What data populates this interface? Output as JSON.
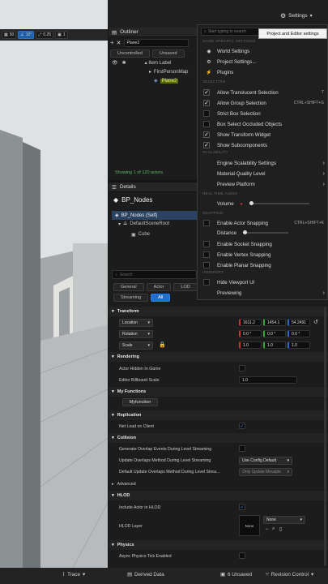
{
  "topbar": {
    "settings_label": "Settings",
    "tooltip": "Project and Editor settings"
  },
  "viewport": {
    "chips": [
      "50",
      "10°",
      "0.25",
      "1"
    ]
  },
  "outliner": {
    "title": "Outliner",
    "search_value": "Plane2",
    "filters": [
      "Uncontrolled",
      "Unsaved"
    ],
    "column_label": "Item Label",
    "tree": [
      "FirstPersonMap",
      "Plane2"
    ],
    "showing": "Showing 1 of 120 actors"
  },
  "details": {
    "title": "Details",
    "actor_name": "BP_Nodes",
    "components": [
      "BP_Nodes (Self)",
      "DefaultSceneRoot",
      "Cube"
    ],
    "search_placeholder": "Search",
    "filter_tabs": [
      "General",
      "Actor",
      "LOD",
      "Streaming",
      "All"
    ],
    "sections": {
      "transform": "Transform",
      "rendering": "Rendering",
      "functions": "My Functions",
      "replication": "Replication",
      "collision": "Collision",
      "advanced": "Advanced",
      "hlod": "HLOD",
      "physics": "Physics"
    },
    "transform": {
      "location_label": "Location",
      "rotation_label": "Rotation",
      "scale_label": "Scale",
      "location": [
        "1611.2",
        "1454.1",
        "54.2491"
      ],
      "rotation": [
        "0.0 °",
        "0.0 °",
        "0.0 °"
      ],
      "scale": [
        "1.0",
        "1.0",
        "1.0"
      ]
    },
    "rendering": {
      "actor_hidden": "Actor Hidden In Game",
      "billboard": "Editor Billboard Scale",
      "billboard_value": "1.0"
    },
    "my_function": "Myfunction",
    "net_load": "Net Load on Client",
    "collision": {
      "overlap_events": "Generate Overlap Events During Level Streaming",
      "update_overlaps": "Update Overlaps Method During Level Streaming",
      "update_overlaps_value": "Use Config Default",
      "default_update": "Default Update Overlaps Method During Level Strea...",
      "default_update_value": "Only Update Movable"
    },
    "hlod": {
      "include": "Include Actor in HLOD",
      "layer": "HLOD Layer",
      "layer_thumb": "None",
      "layer_value": "None"
    },
    "physics": {
      "async": "Async Physics Tick Enabled"
    }
  },
  "menu": {
    "search_placeholder": "Start typing to search",
    "headers": {
      "game": "GAME SPECIFIC SETTINGS",
      "selection": "SELECTION",
      "scalability": "SCALABILITY",
      "realtime": "REAL TIME AUDIO",
      "snapping": "SNAPPING",
      "viewport": "VIEWPORT"
    },
    "game_items": [
      "World Settings",
      "Project Settings...",
      "Plugins"
    ],
    "selection_items": [
      {
        "label": "Allow Translucent Selection",
        "shortcut": "T",
        "checked": true
      },
      {
        "label": "Allow Group Selection",
        "shortcut": "CTRL+SHIFT+G",
        "checked": true
      },
      {
        "label": "Strict Box Selection",
        "shortcut": "",
        "checked": false
      },
      {
        "label": "Box Select Occluded Objects",
        "shortcut": "",
        "checked": false
      },
      {
        "label": "Show Transform Widget",
        "shortcut": "",
        "checked": true
      },
      {
        "label": "Show Subcomponents",
        "shortcut": "",
        "checked": true
      }
    ],
    "scalability_items": [
      "Engine Scalability Settings",
      "Material Quality Level",
      "Preview Platform"
    ],
    "volume_label": "Volume",
    "snapping_items": [
      {
        "label": "Enable Actor Snapping",
        "shortcut": "CTRL+SHIFT+K",
        "checked": false
      },
      {
        "label": "Enable Socket Snapping",
        "shortcut": "",
        "checked": false
      },
      {
        "label": "Enable Vertex Snapping",
        "shortcut": "",
        "checked": false
      },
      {
        "label": "Enable Planar Snapping",
        "shortcut": "",
        "checked": false
      }
    ],
    "distance_label": "Distance",
    "viewport_items": [
      "Hide Viewport UI",
      "Previewing"
    ]
  },
  "statusbar": {
    "trace": "Trace",
    "derived": "Derived Data",
    "unsaved": "6 Unsaved",
    "revision": "Revision Control"
  },
  "colors": {
    "accent": "#2b8eff",
    "green": "#5bb86a"
  }
}
